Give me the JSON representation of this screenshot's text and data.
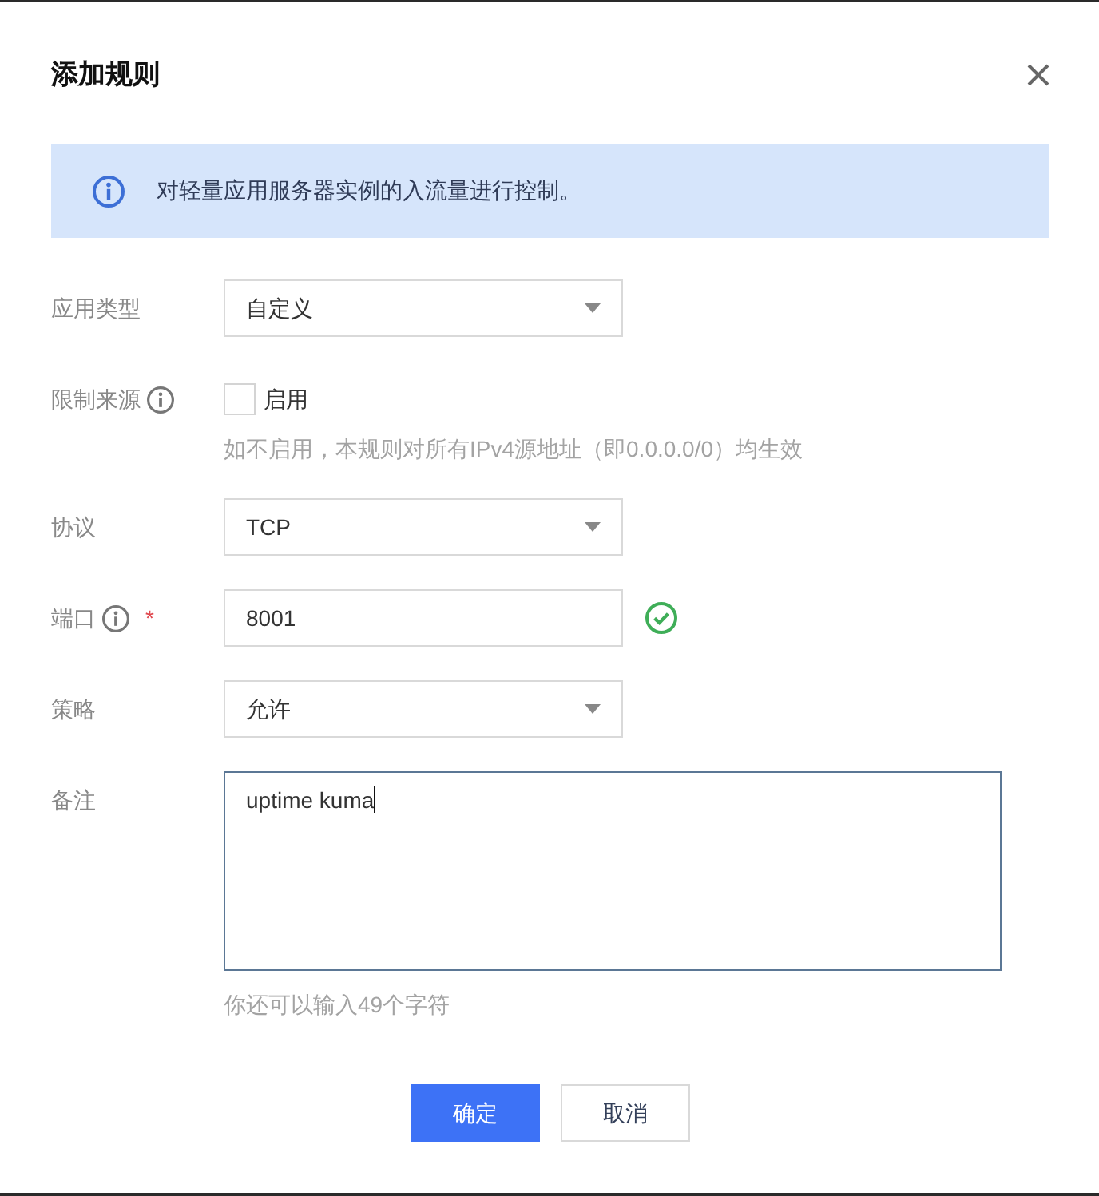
{
  "dialog": {
    "title": "添加规则"
  },
  "notice": {
    "text": "对轻量应用服务器实例的入流量进行控制。"
  },
  "fields": [
    {
      "kind": "select",
      "label": "应用类型",
      "value": "自定义"
    },
    {
      "kind": "checkbox",
      "label": "限制来源",
      "info": true,
      "option": "启用",
      "checked": false,
      "hint": "如不启用，本规则对所有IPv4源地址（即0.0.0.0/0）均生效"
    },
    {
      "kind": "select",
      "label": "协议",
      "value": "TCP"
    },
    {
      "kind": "input",
      "label": "端口",
      "info": true,
      "required_mark": "*",
      "value": "8001",
      "valid": true
    },
    {
      "kind": "select",
      "label": "策略",
      "value": "允许"
    },
    {
      "kind": "textarea",
      "label": "备注",
      "value": "uptime kuma",
      "focused": true,
      "hint": "你还可以输入49个字符"
    }
  ],
  "buttons": [
    {
      "label": "确定",
      "primary": true
    },
    {
      "label": "取消",
      "primary": false
    }
  ]
}
